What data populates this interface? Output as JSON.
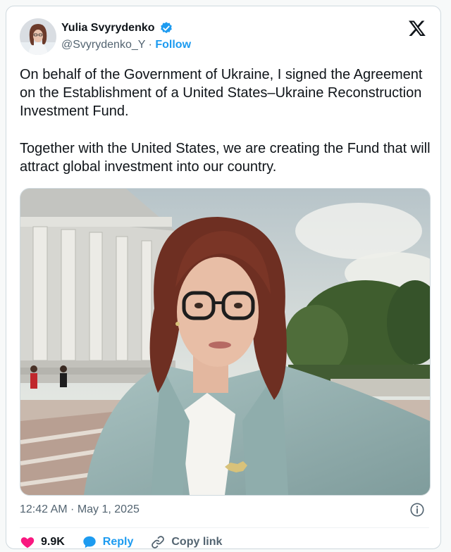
{
  "author": {
    "name": "Yulia Svyrydenko",
    "handle": "@Svyrydenko_Y",
    "separator": "·",
    "follow_label": "Follow",
    "verified_icon": "verified-badge-icon",
    "avatar_icon": "avatar"
  },
  "platform_logo": "x-logo-icon",
  "tweet": {
    "paragraphs": [
      "On behalf of the Government of Ukraine, I signed the Agreement on the Establishment of a United States–Ukraine Reconstruction Investment Fund.",
      "Together with the United States, we are creating the Fund that will attract global investment into our country."
    ]
  },
  "meta": {
    "timestamp": "12:42 AM · May 1, 2025",
    "info_icon": "info-icon"
  },
  "actions": {
    "like_count": "9.9K",
    "reply_label": "Reply",
    "copy_link_label": "Copy link"
  },
  "colors": {
    "accent": "#1d9bf0",
    "like": "#f91880",
    "text": "#0f1419",
    "secondary": "#536471",
    "border": "#cfd9de"
  }
}
